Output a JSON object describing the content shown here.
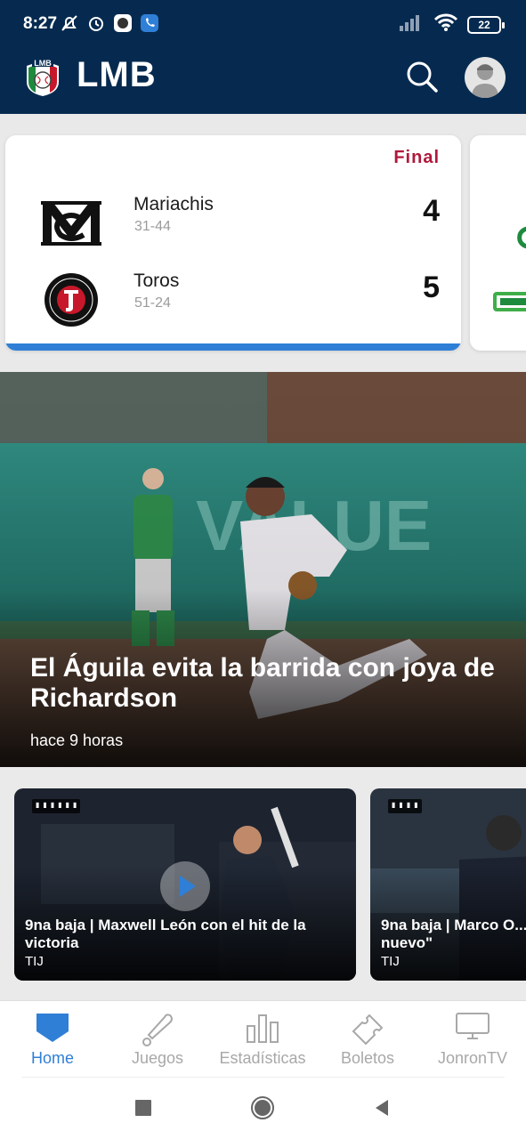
{
  "status_bar": {
    "time": "8:27",
    "battery": "22"
  },
  "header": {
    "brand": "LMB"
  },
  "scores": {
    "games": [
      {
        "status": "Final",
        "away": {
          "name": "Mariachis",
          "record": "31-44",
          "score": "4"
        },
        "home": {
          "name": "Toros",
          "record": "51-24",
          "score": "5"
        }
      }
    ]
  },
  "hero": {
    "title": "El Águila evita la barrida con joya de Richardson",
    "time": "hace 9 horas"
  },
  "videos": [
    {
      "title": "9na baja | Maxwell León con el hit de la victoria",
      "team": "TIJ"
    },
    {
      "title": "9na baja | Marco O... nuevo\"",
      "team": "TIJ"
    }
  ],
  "bottom_nav": [
    {
      "label": "Home",
      "icon": "home-icon",
      "active": true
    },
    {
      "label": "Juegos",
      "icon": "bat-icon"
    },
    {
      "label": "Estadísticas",
      "icon": "stats-icon"
    },
    {
      "label": "Boletos",
      "icon": "ticket-icon"
    },
    {
      "label": "JonronTV",
      "icon": "tv-icon"
    }
  ],
  "colors": {
    "header_bg": "#062a4f",
    "accent_blue": "#2f7fd6",
    "final_red": "#b0183a"
  }
}
